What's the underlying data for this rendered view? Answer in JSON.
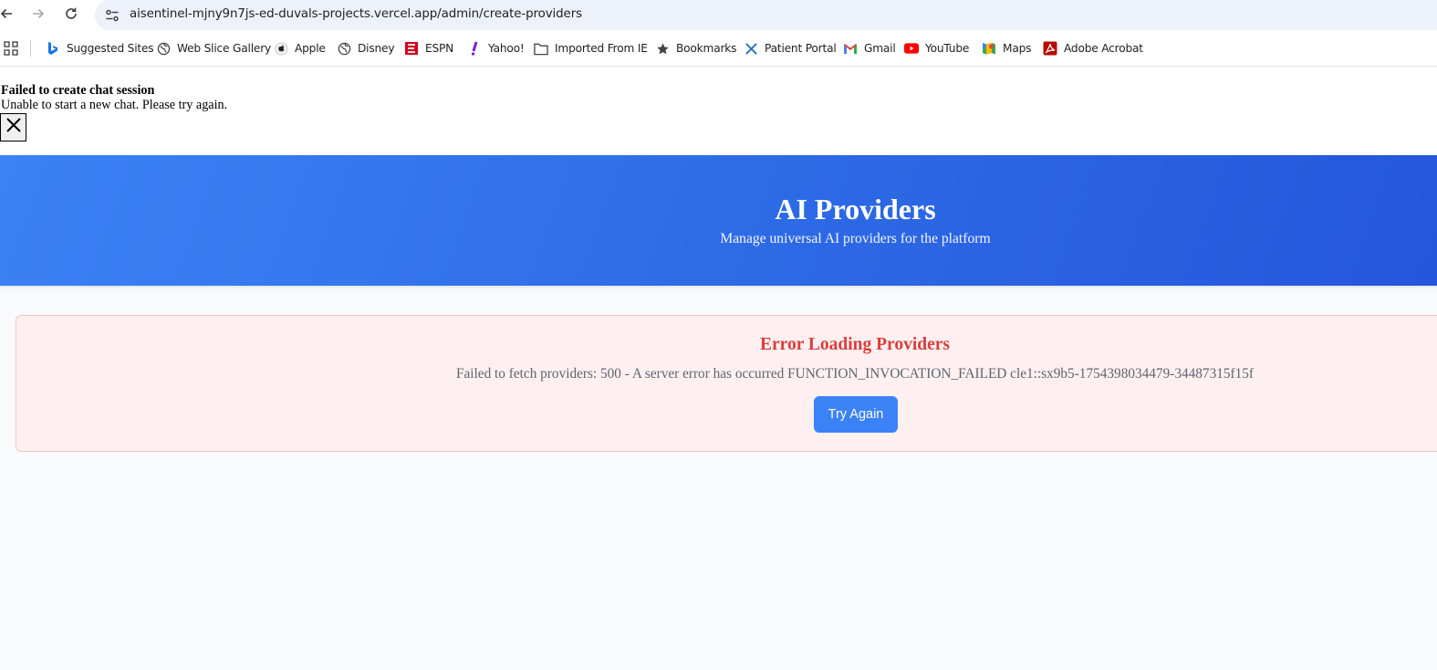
{
  "browser": {
    "url": "aisentinel-mjny9n7js-ed-duvals-projects.vercel.app/admin/create-providers",
    "bookmarks": [
      {
        "label": "Suggested Sites",
        "icon": "bing-icon"
      },
      {
        "label": "Web Slice Gallery",
        "icon": "globe-icon"
      },
      {
        "label": "Apple",
        "icon": "apple-icon"
      },
      {
        "label": "Disney",
        "icon": "globe-icon"
      },
      {
        "label": "ESPN",
        "icon": "espn-icon"
      },
      {
        "label": "Yahoo!",
        "icon": "yahoo-icon"
      },
      {
        "label": "Imported From IE",
        "icon": "folder-icon"
      },
      {
        "label": "Bookmarks",
        "icon": "star-icon"
      },
      {
        "label": "Patient Portal",
        "icon": "portal-icon"
      },
      {
        "label": "Gmail",
        "icon": "gmail-icon"
      },
      {
        "label": "YouTube",
        "icon": "youtube-icon"
      },
      {
        "label": "Maps",
        "icon": "maps-icon"
      },
      {
        "label": "Adobe Acrobat",
        "icon": "acrobat-icon"
      }
    ]
  },
  "toast": {
    "title": "Failed to create chat session",
    "message": "Unable to start a new chat. Please try again."
  },
  "header": {
    "title": "AI Providers",
    "subtitle": "Manage universal AI providers for the platform"
  },
  "error": {
    "title": "Error Loading Providers",
    "message": "Failed to fetch providers: 500 - A server error has occurred FUNCTION_INVOCATION_FAILED cle1::sx9b5-1754398034479-34487315f15f",
    "retry_label": "Try Again"
  },
  "colors": {
    "hero_start": "#3b82f6",
    "hero_end": "#2456dc",
    "error_title": "#dc3c3c",
    "error_bg": "#fef0f0",
    "button": "#3b82f6"
  }
}
